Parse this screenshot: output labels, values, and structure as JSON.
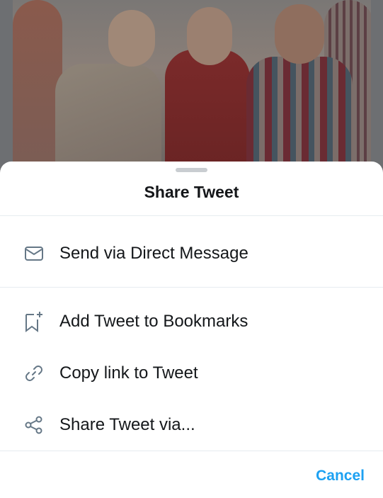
{
  "sheet": {
    "title": "Share Tweet",
    "items": [
      {
        "label": "Send via Direct Message",
        "icon": "envelope-icon"
      },
      {
        "label": "Add Tweet to Bookmarks",
        "icon": "bookmark-add-icon"
      },
      {
        "label": "Copy link to Tweet",
        "icon": "link-icon"
      },
      {
        "label": "Share Tweet via...",
        "icon": "share-icon"
      }
    ],
    "cancel_label": "Cancel"
  },
  "colors": {
    "accent": "#1da1f2",
    "icon": "#657786",
    "text": "#14171a",
    "divider": "#e6ecf0"
  }
}
